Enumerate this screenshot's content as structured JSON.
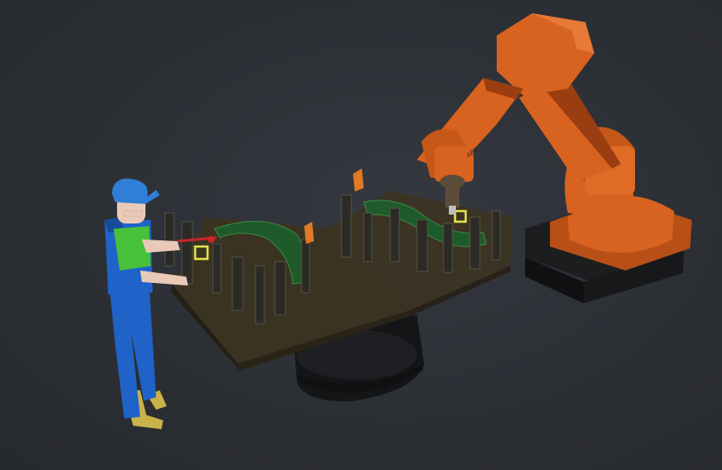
{
  "viewport": {
    "background_color": "#2c2f34"
  },
  "scene": {
    "robot": {
      "brand_label": "ABB",
      "body_color": "#d8621f",
      "shadow_color": "#9a3d10",
      "base_color": "#1c1d1f"
    },
    "operator": {
      "cap_color": "#2f7fd8",
      "overalls_color": "#1f63c8",
      "shirt_color": "#47c23a",
      "skin_color": "#e9c9b8",
      "boot_color": "#c9b24a"
    },
    "fixture": {
      "table_color": "#3a3322",
      "part_color": "#1f5a2a",
      "rotary_base_color": "#151618",
      "clamp_highlight_color": "#e07a25",
      "marker_color": "#e3e04a",
      "accent_red": "#c8262a"
    }
  }
}
